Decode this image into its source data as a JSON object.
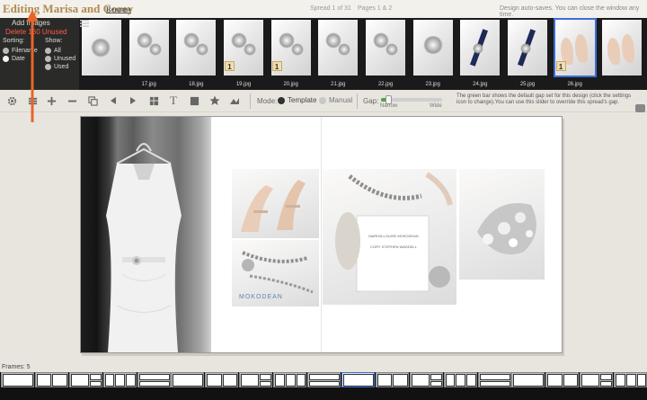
{
  "header": {
    "title": "Editing Marisa and Corey",
    "rename_label": "Rename",
    "spread_indicator": "Spread 1 of 31",
    "pages_indicator": "Pages 1 & 2",
    "autosave_notice": "Design auto-saves. You can close the window any time."
  },
  "image_panel": {
    "add_images_label": "Add Images",
    "delete_unused_label": "Delete 160 Unused",
    "sorting_label": "Sorting:",
    "sorting_options": [
      {
        "label": "Filename",
        "selected": false
      },
      {
        "label": "Date",
        "selected": true
      }
    ],
    "show_label": "Show:",
    "show_options": [
      {
        "label": "All",
        "selected": false
      },
      {
        "label": "Unused",
        "selected": false
      },
      {
        "label": "Used",
        "selected": false
      }
    ]
  },
  "filmstrip": {
    "thumbnails": [
      {
        "label": "",
        "used_count": "",
        "kind": "dress-corner"
      },
      {
        "label": "17.jpg",
        "used_count": "",
        "kind": "bracelet"
      },
      {
        "label": "18.jpg",
        "used_count": "",
        "kind": "bracelet"
      },
      {
        "label": "19.jpg",
        "used_count": "1",
        "kind": "invitation"
      },
      {
        "label": "20.jpg",
        "used_count": "1",
        "kind": "bracelet"
      },
      {
        "label": "21.jpg",
        "used_count": "",
        "kind": "bracelet"
      },
      {
        "label": "22.jpg",
        "used_count": "",
        "kind": "bracelet"
      },
      {
        "label": "23.jpg",
        "used_count": "",
        "kind": "garter"
      },
      {
        "label": "24.jpg",
        "used_count": "",
        "kind": "ribbon"
      },
      {
        "label": "25.jpg",
        "used_count": "",
        "kind": "ribbon"
      },
      {
        "label": "26.jpg",
        "used_count": "1",
        "kind": "shoes"
      },
      {
        "label": "",
        "used_count": "",
        "kind": "shoes"
      }
    ]
  },
  "toolbar": {
    "mode_label": "Mode:",
    "mode_template_label": "Template",
    "mode_manual_label": "Manual",
    "mode_selected": "Template",
    "gap_label": "Gap:",
    "gap_narrow_label": "Narrow",
    "gap_wide_label": "Wide",
    "gap_value": 0.08,
    "gap_help_text": "The green bar shows the default gap set for this design (click the settings icon to change).You can use this slider to override this spread's gap.",
    "icons": [
      "gear-icon",
      "list-icon",
      "plus-icon",
      "copy-icon",
      "arrow-left-icon",
      "arrow-right-icon",
      "layout-grid-icon",
      "text-icon",
      "square-icon",
      "star-icon",
      "image-sort-icon"
    ]
  },
  "spread": {
    "photos": [
      "dress",
      "shoes",
      "bracelet",
      "invitation",
      "brooch"
    ],
    "invitation_text": {
      "line1": "MARISA LOUISE MOKODEAN",
      "line2": "CORY STEPHEN WADDELL"
    },
    "bracelet_card_text": "MOKODEAN",
    "thumb_card_text": "MOKODEAN"
  },
  "frames": {
    "label": "Frames: 5",
    "count": 19
  },
  "colors": {
    "title_gold": "#b08a4e",
    "delete_red": "#ff5a4a",
    "arrow_orange": "#e8652a",
    "gap_green": "#46a546",
    "selected_blue": "#3b6fd4"
  }
}
